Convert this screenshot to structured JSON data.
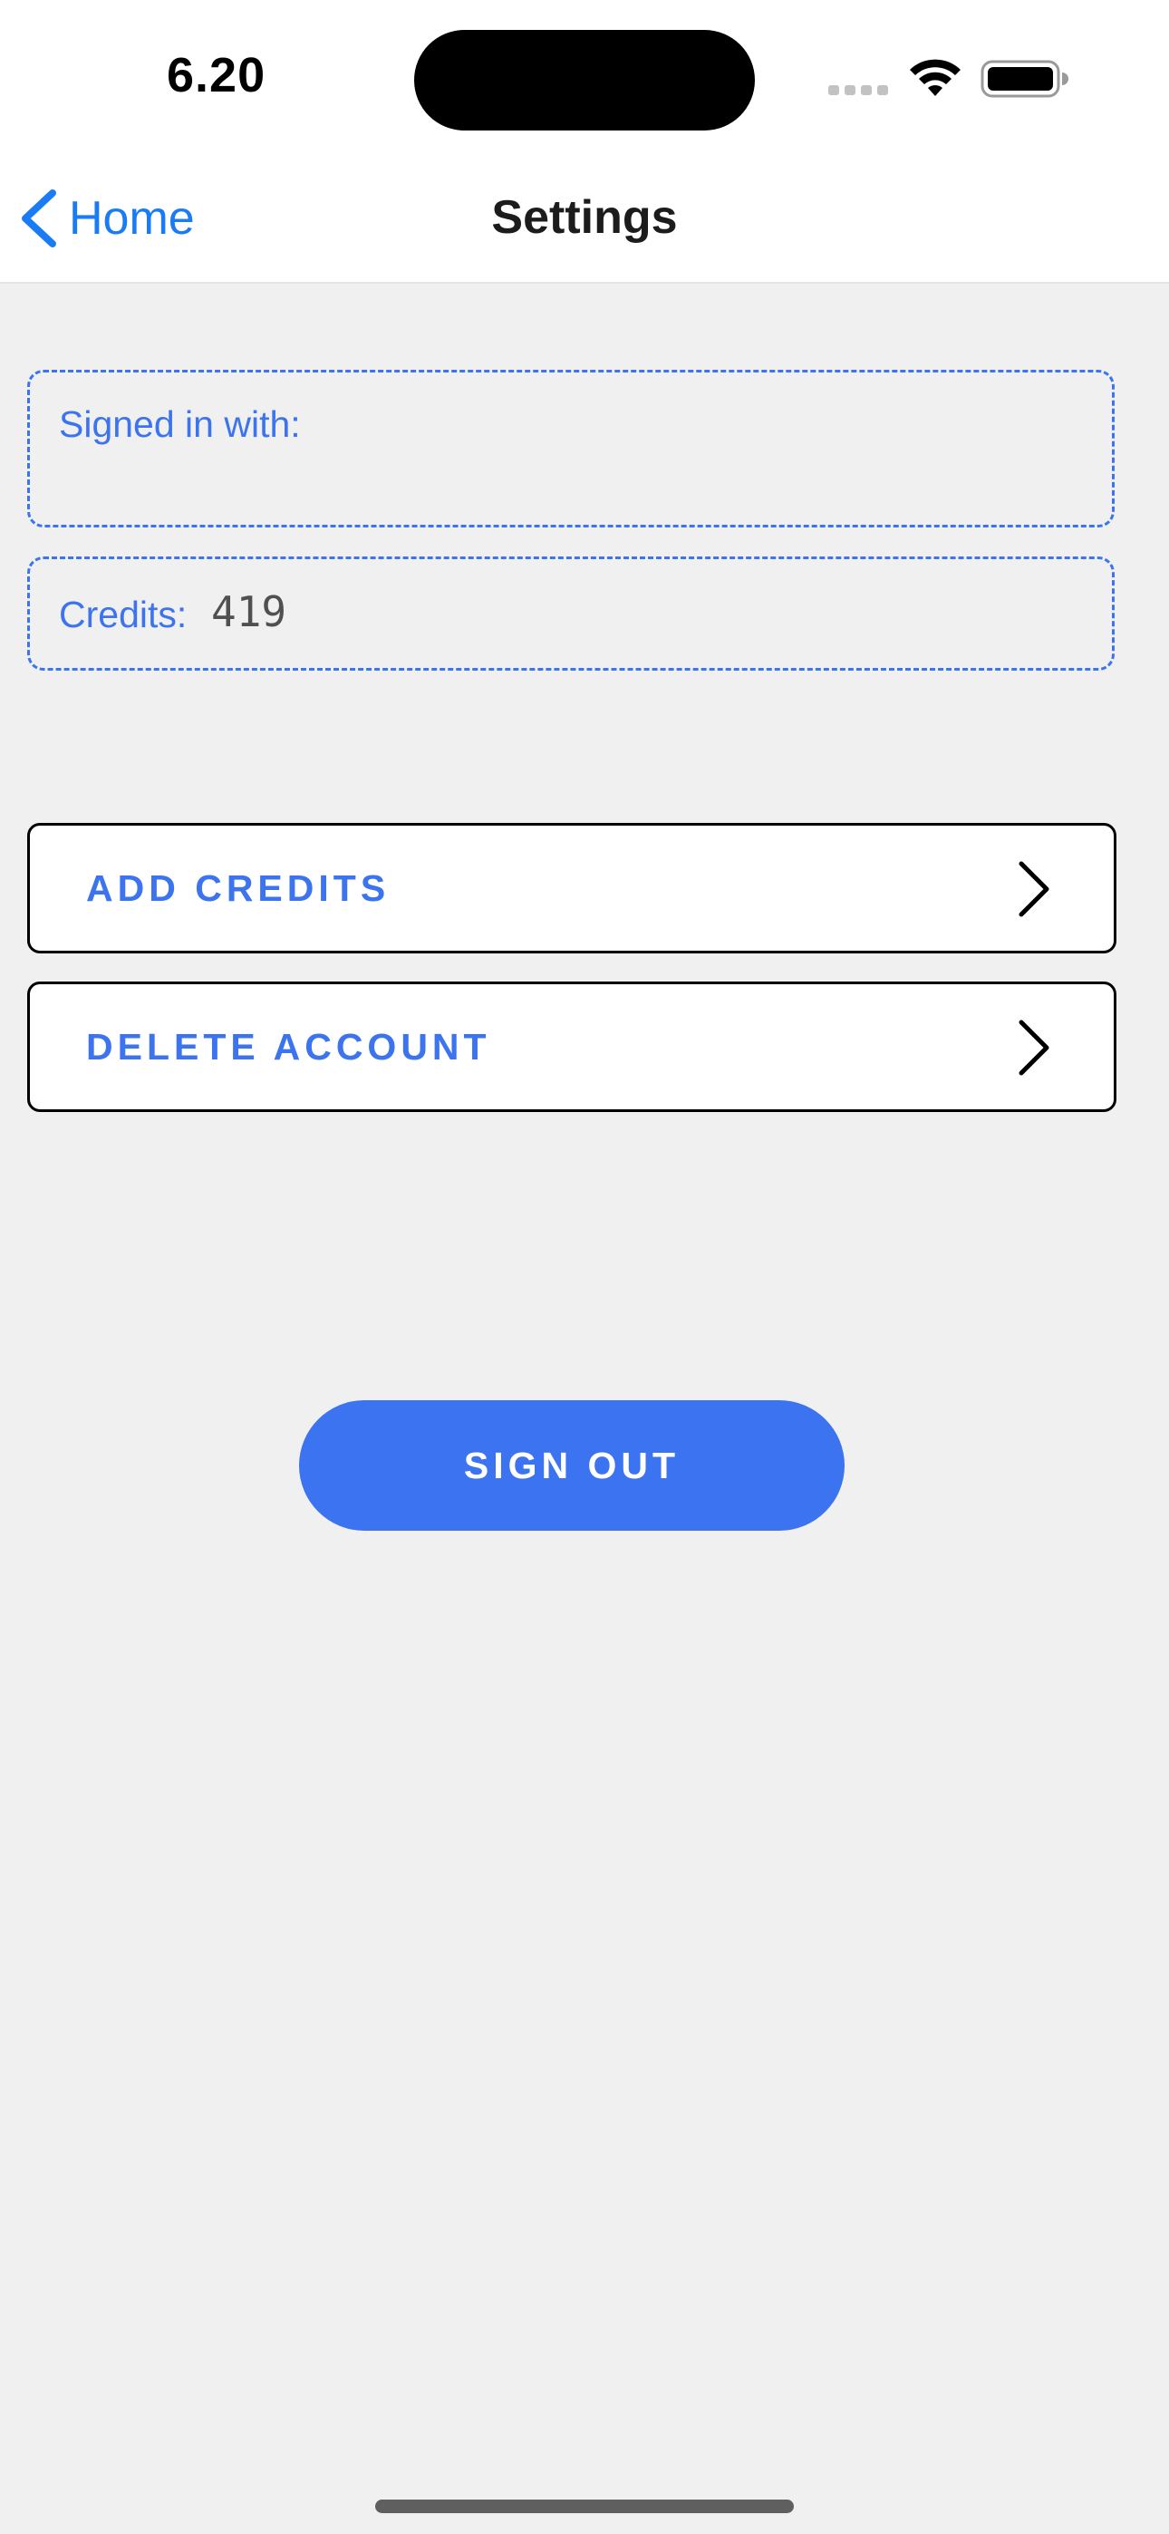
{
  "status_bar": {
    "time": "6.20",
    "icons": [
      "signal-icon",
      "wifi-icon",
      "battery-icon"
    ]
  },
  "nav": {
    "back_label": "Home",
    "title": "Settings",
    "back_icon": "chevron-left-icon"
  },
  "account": {
    "signed_in_label": "Signed in with:",
    "signed_in_value": "",
    "credits_label": "Credits:",
    "credits_value": "419"
  },
  "menu": {
    "items": [
      {
        "label": "ADD CREDITS",
        "icon": "chevron-right-icon"
      },
      {
        "label": "DELETE ACCOUNT",
        "icon": "chevron-right-icon"
      }
    ]
  },
  "actions": {
    "sign_out_label": "SIGN OUT"
  },
  "colors": {
    "accent": "#3c73ee",
    "ios_link": "#1a7cf5",
    "background": "#f0f0f0",
    "surface": "#ffffff",
    "border": "#000000"
  }
}
